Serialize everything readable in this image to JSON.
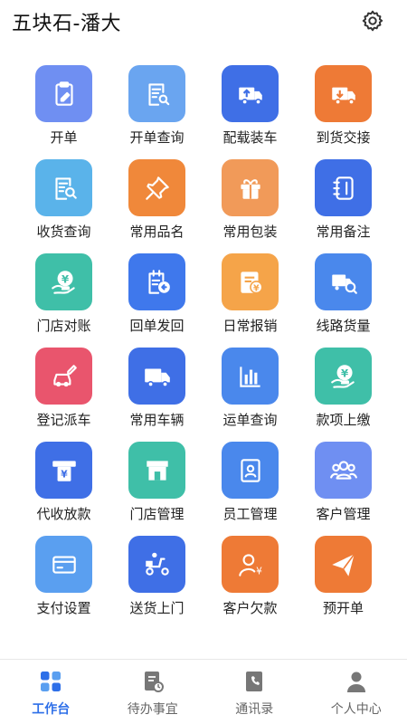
{
  "header": {
    "title": "五块石-潘大",
    "settings_icon": "gear-icon"
  },
  "menu": [
    {
      "label": "开单",
      "icon": "clipboard-pen-icon",
      "color": "#6f8ff2"
    },
    {
      "label": "开单查询",
      "icon": "document-search-icon",
      "color": "#6aa5f0"
    },
    {
      "label": "配载装车",
      "icon": "truck-load-icon",
      "color": "#3f6fe6"
    },
    {
      "label": "到货交接",
      "icon": "truck-arrive-icon",
      "color": "#ee7a36"
    },
    {
      "label": "收货查询",
      "icon": "receipt-search-icon",
      "color": "#5ab3ea"
    },
    {
      "label": "常用品名",
      "icon": "pin-icon",
      "color": "#f0883a"
    },
    {
      "label": "常用包装",
      "icon": "gift-box-icon",
      "color": "#f19a59"
    },
    {
      "label": "常用备注",
      "icon": "notebook-icon",
      "color": "#3f6fe6"
    },
    {
      "label": "门店对账",
      "icon": "hand-yen-icon",
      "color": "#3fbfa8"
    },
    {
      "label": "回单发回",
      "icon": "receipt-return-icon",
      "color": "#3f78ec"
    },
    {
      "label": "日常报销",
      "icon": "invoice-yen-icon",
      "color": "#f5a449"
    },
    {
      "label": "线路货量",
      "icon": "route-search-icon",
      "color": "#4a88ec"
    },
    {
      "label": "登记派车",
      "icon": "car-register-icon",
      "color": "#e9556d"
    },
    {
      "label": "常用车辆",
      "icon": "truck-icon",
      "color": "#3f6fe6"
    },
    {
      "label": "运单查询",
      "icon": "bar-chart-icon",
      "color": "#4a88ec"
    },
    {
      "label": "款项上缴",
      "icon": "hand-yen-icon",
      "color": "#3fbfa8"
    },
    {
      "label": "代收放款",
      "icon": "atm-yen-icon",
      "color": "#3f6fe6"
    },
    {
      "label": "门店管理",
      "icon": "store-icon",
      "color": "#3fbfa8"
    },
    {
      "label": "员工管理",
      "icon": "id-card-icon",
      "color": "#4a88ec"
    },
    {
      "label": "客户管理",
      "icon": "users-icon",
      "color": "#6f8ff2"
    },
    {
      "label": "支付设置",
      "icon": "card-icon",
      "color": "#5a9ff0"
    },
    {
      "label": "送货上门",
      "icon": "delivery-scooter-icon",
      "color": "#3f6fe6"
    },
    {
      "label": "客户欠款",
      "icon": "person-yen-icon",
      "color": "#ee7a36"
    },
    {
      "label": "预开单",
      "icon": "paper-plane-icon",
      "color": "#ee7a36"
    }
  ],
  "tabbar": {
    "active_color": "#2e6fe8",
    "items": [
      {
        "label": "工作台",
        "icon": "grid-icon",
        "active": true
      },
      {
        "label": "待办事宜",
        "icon": "todo-icon",
        "active": false
      },
      {
        "label": "通讯录",
        "icon": "phone-book-icon",
        "active": false
      },
      {
        "label": "个人中心",
        "icon": "person-icon",
        "active": false
      }
    ]
  }
}
